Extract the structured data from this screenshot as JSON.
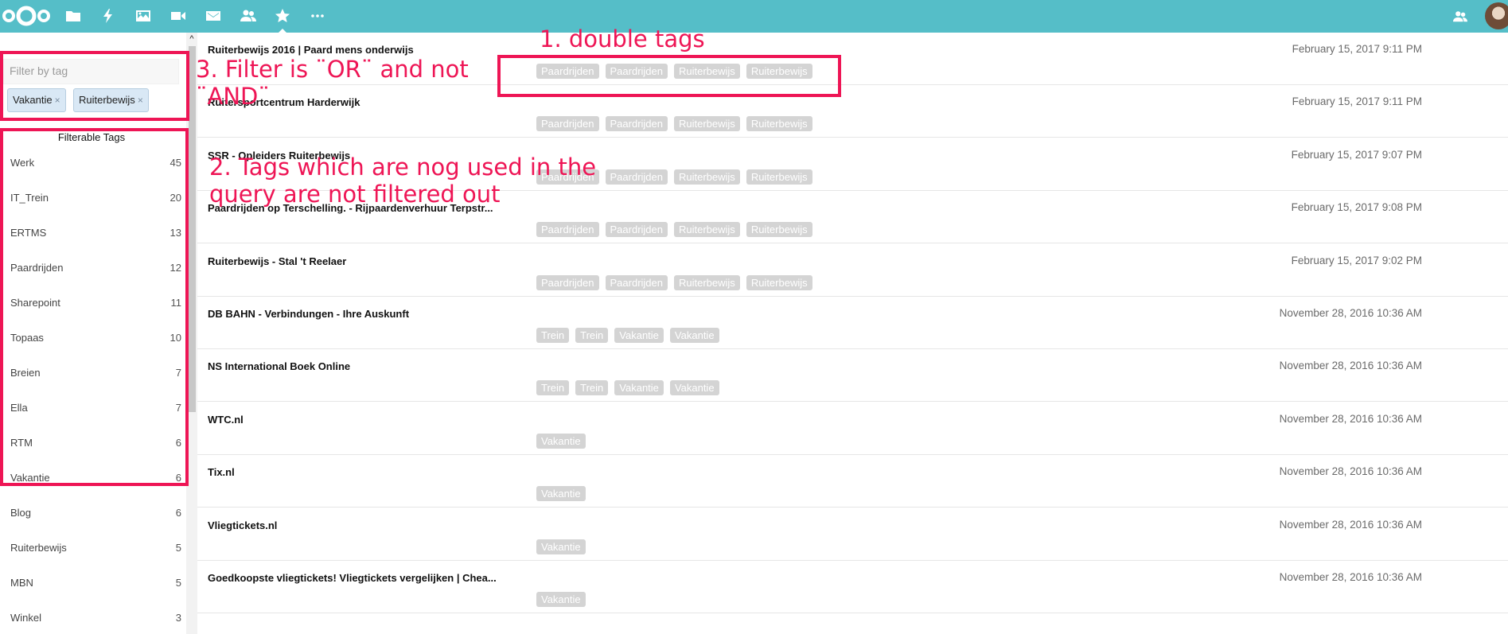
{
  "colors": {
    "header": "#55bec8",
    "accent": "#ee1555",
    "tag_bg": "#d4d4d4",
    "chip_bg": "#d9e8f5"
  },
  "header": {
    "apps": [
      {
        "name": "files",
        "icon": "folder-icon"
      },
      {
        "name": "activity",
        "icon": "lightning-icon"
      },
      {
        "name": "gallery",
        "icon": "image-icon"
      },
      {
        "name": "video",
        "icon": "video-icon"
      },
      {
        "name": "mail",
        "icon": "envelope-icon"
      },
      {
        "name": "contacts",
        "icon": "people-icon"
      },
      {
        "name": "bookmarks",
        "icon": "star-icon",
        "active": true
      },
      {
        "name": "more",
        "icon": "more-icon"
      }
    ],
    "right_icon": "contacts-icon",
    "avatar_icon": "user-avatar"
  },
  "sidebar": {
    "filter_placeholder": "Filter by tag",
    "chips": [
      "Vakantie",
      "Ruiterbewijs"
    ],
    "chip_remove": "×",
    "tags_title": "Filterable Tags",
    "tags": [
      {
        "label": "Werk",
        "count": "45"
      },
      {
        "label": "IT_Trein",
        "count": "20"
      },
      {
        "label": "ERTMS",
        "count": "13"
      },
      {
        "label": "Paardrijden",
        "count": "12"
      },
      {
        "label": "Sharepoint",
        "count": "11"
      },
      {
        "label": "Topaas",
        "count": "10"
      },
      {
        "label": "Breien",
        "count": "7"
      },
      {
        "label": "Ella",
        "count": "7"
      },
      {
        "label": "RTM",
        "count": "6"
      },
      {
        "label": "Vakantie",
        "count": "6"
      },
      {
        "label": "Blog",
        "count": "6"
      },
      {
        "label": "Ruiterbewijs",
        "count": "5"
      },
      {
        "label": "MBN",
        "count": "5"
      },
      {
        "label": "Winkel",
        "count": "3"
      }
    ]
  },
  "bookmarks": [
    {
      "title": "Ruiterbewijs 2016 | Paard mens onderwijs",
      "date": "February 15, 2017 9:11 PM",
      "tags": [
        "Paardrijden",
        "Paardrijden",
        "Ruiterbewijs",
        "Ruiterbewijs"
      ]
    },
    {
      "title": "Ruitersportcentrum Harderwijk",
      "date": "February 15, 2017 9:11 PM",
      "tags": [
        "Paardrijden",
        "Paardrijden",
        "Ruiterbewijs",
        "Ruiterbewijs"
      ]
    },
    {
      "title": "SSR - Opleiders Ruiterbewijs",
      "date": "February 15, 2017 9:07 PM",
      "tags": [
        "Paardrijden",
        "Paardrijden",
        "Ruiterbewijs",
        "Ruiterbewijs"
      ]
    },
    {
      "title": "Paardrijden op Terschelling. - Rijpaardenverhuur Terpstr...",
      "date": "February 15, 2017 9:08 PM",
      "tags": [
        "Paardrijden",
        "Paardrijden",
        "Ruiterbewijs",
        "Ruiterbewijs"
      ]
    },
    {
      "title": "Ruiterbewijs - Stal 't Reelaer",
      "date": "February 15, 2017 9:02 PM",
      "tags": [
        "Paardrijden",
        "Paardrijden",
        "Ruiterbewijs",
        "Ruiterbewijs"
      ]
    },
    {
      "title": "DB BAHN - Verbindungen - Ihre Auskunft",
      "date": "November 28, 2016 10:36 AM",
      "tags": [
        "Trein",
        "Trein",
        "Vakantie",
        "Vakantie"
      ]
    },
    {
      "title": "NS International Boek Online",
      "date": "November 28, 2016 10:36 AM",
      "tags": [
        "Trein",
        "Trein",
        "Vakantie",
        "Vakantie"
      ]
    },
    {
      "title": "WTC.nl",
      "date": "November 28, 2016 10:36 AM",
      "tags": [
        "Vakantie"
      ]
    },
    {
      "title": "Tix.nl",
      "date": "November 28, 2016 10:36 AM",
      "tags": [
        "Vakantie"
      ]
    },
    {
      "title": "Vliegtickets.nl",
      "date": "November 28, 2016 10:36 AM",
      "tags": [
        "Vakantie"
      ]
    },
    {
      "title": "Goedkoopste vliegtickets! Vliegtickets vergelijken | Chea...",
      "date": "November 28, 2016 10:36 AM",
      "tags": [
        "Vakantie"
      ]
    }
  ],
  "annotations": {
    "double_tags": "1. double  tags",
    "not_filtered_line1": "2. Tags which are nog used in the",
    "not_filtered_line2": "query are not filtered out",
    "or_and_line1": "3. Filter is ¨OR¨ and not",
    "or_and_line2": "¨AND¨"
  }
}
